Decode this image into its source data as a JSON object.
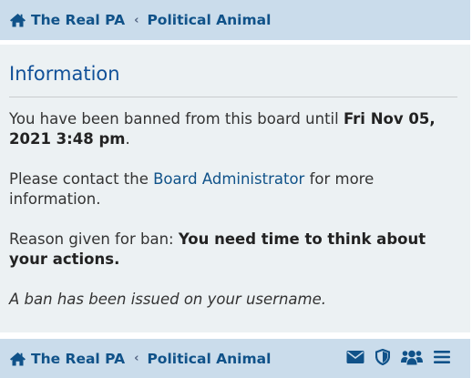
{
  "breadcrumb": {
    "home_label": "The Real PA",
    "forum_label": "Political Animal"
  },
  "panel": {
    "title": "Information",
    "banned_prefix": "You have been banned from this board until ",
    "ban_until": "Fri Nov 05, 2021 3:48 pm",
    "banned_suffix": ".",
    "contact_prefix": "Please contact the ",
    "contact_link": "Board Administrator",
    "contact_suffix": " for more information.",
    "reason_label": "Reason given for ban: ",
    "reason_text": "You need time to think about your actions.",
    "ban_notice": "A ban has been issued on your username."
  },
  "icons": {
    "home": "home-icon",
    "separator": "chevron-left-icon",
    "messages": "envelope-icon",
    "moderation": "shield-icon",
    "members": "users-icon",
    "menu": "hamburger-menu-icon"
  },
  "colors": {
    "navbar_bg": "#cadceb",
    "panel_bg": "#ecf1f3",
    "link": "#105289",
    "title": "#115098",
    "text": "#333333"
  }
}
